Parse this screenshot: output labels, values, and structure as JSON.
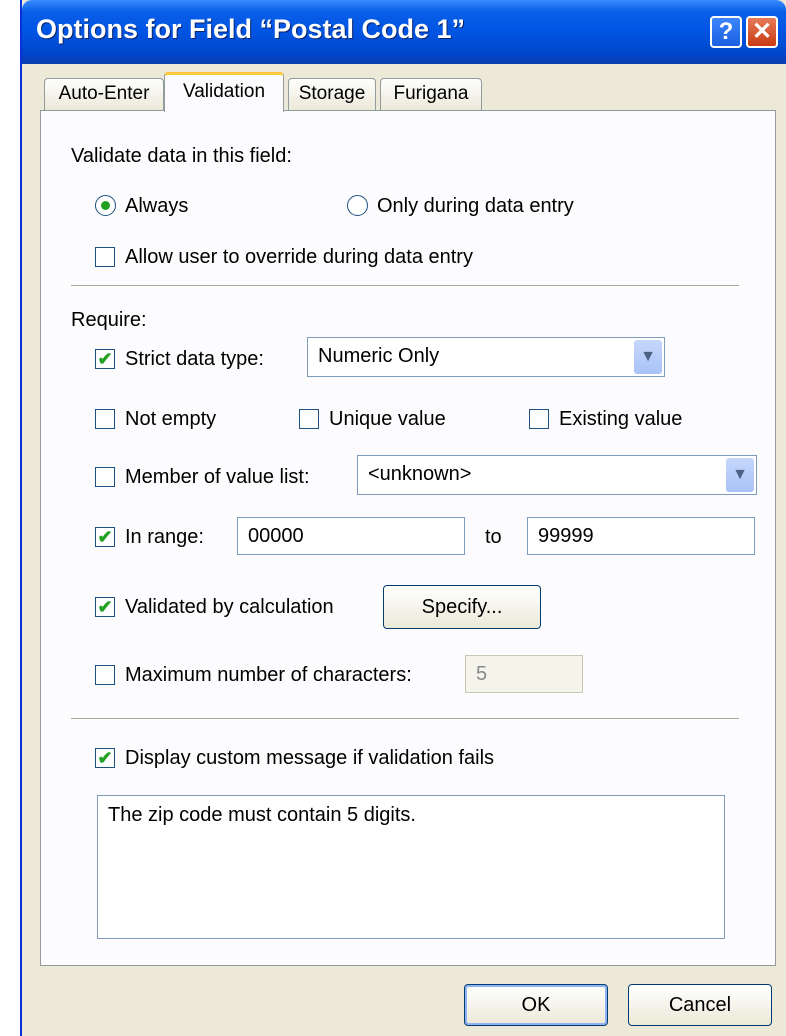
{
  "window": {
    "title": "Options for Field “Postal Code 1”",
    "help_glyph": "?",
    "close_glyph": "✕"
  },
  "tabs": [
    {
      "label": "Auto-Enter"
    },
    {
      "label": "Validation",
      "active": true
    },
    {
      "label": "Storage"
    },
    {
      "label": "Furigana"
    }
  ],
  "validate": {
    "heading": "Validate data in this field:",
    "always_label": "Always",
    "always_selected": true,
    "data_entry_label": "Only during data entry",
    "override_label": "Allow user to override during data entry",
    "override_checked": false
  },
  "require": {
    "heading": "Require:",
    "strict_label": "Strict data type:",
    "strict_checked": true,
    "strict_value": "Numeric Only",
    "not_empty_label": "Not empty",
    "unique_label": "Unique value",
    "existing_label": "Existing value",
    "member_label": "Member of value list:",
    "member_value": "<unknown>",
    "range_label": "In range:",
    "range_checked": true,
    "range_from": "00000",
    "range_to_label": "to",
    "range_to": "99999",
    "calc_label": "Validated by calculation",
    "calc_checked": true,
    "specify_label": "Specify...",
    "max_label": "Maximum number of characters:",
    "max_checked": false,
    "max_value": "5"
  },
  "message": {
    "label": "Display custom message if validation fails",
    "checked": true,
    "text": "The zip code must contain 5 digits."
  },
  "buttons": {
    "ok": "OK",
    "cancel": "Cancel"
  },
  "icons": {
    "check_glyph": "✔",
    "dropdown_glyph": "▼"
  },
  "colors": {
    "titlebar": "#0054e3",
    "check": "#21a121",
    "face": "#ece9d8"
  }
}
